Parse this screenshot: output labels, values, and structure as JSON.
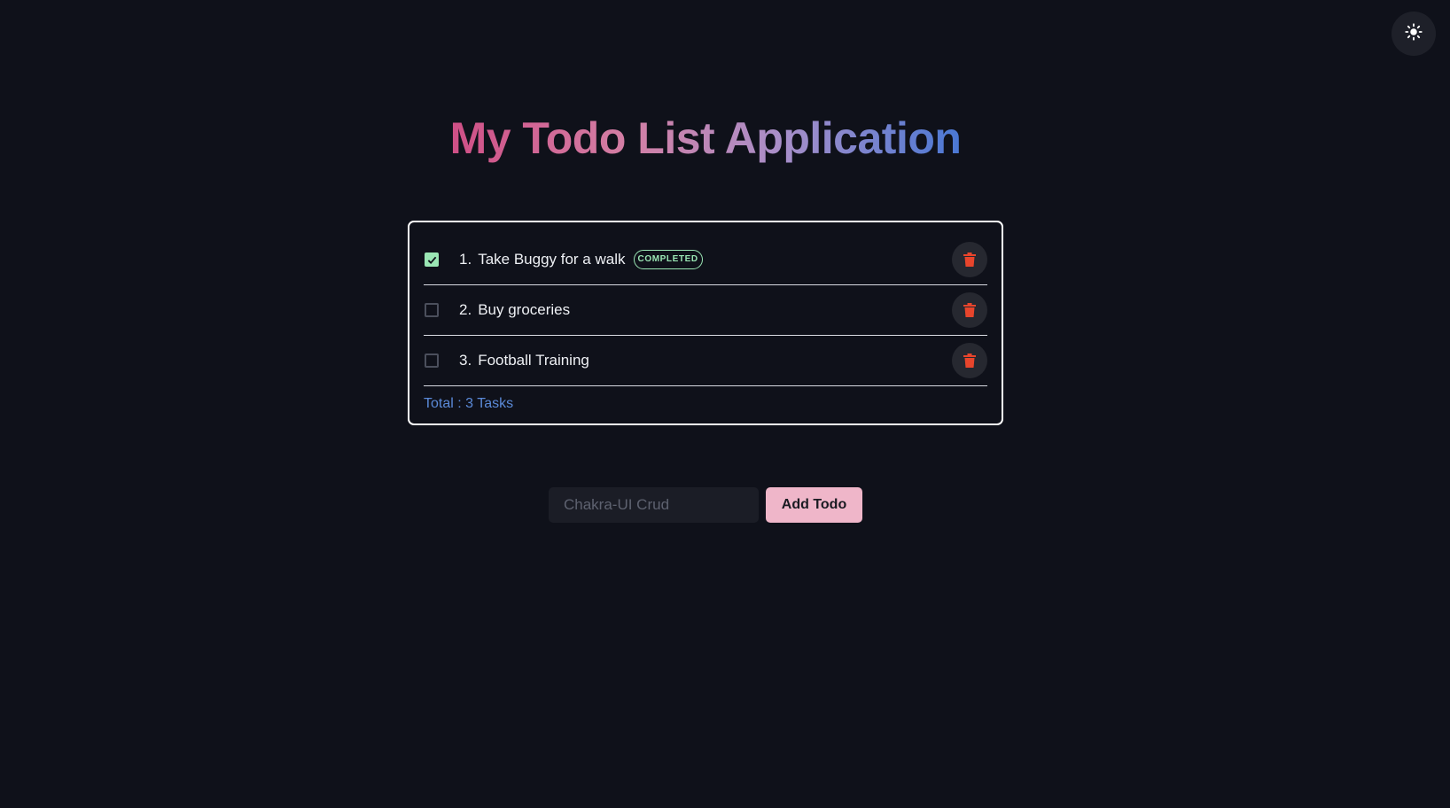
{
  "app": {
    "title": "My Todo List Application",
    "theme_toggle_icon": "sun-icon"
  },
  "todos": [
    {
      "number": "1.",
      "text": "Take Buggy for a walk",
      "completed": true,
      "badge": "COMPLETED",
      "delete_icon": "trash-icon"
    },
    {
      "number": "2.",
      "text": "Buy groceries",
      "completed": false,
      "badge": "",
      "delete_icon": "trash-icon"
    },
    {
      "number": "3.",
      "text": "Football Training",
      "completed": false,
      "badge": "",
      "delete_icon": "trash-icon"
    }
  ],
  "footer": {
    "total_label": "Total : 3 Tasks"
  },
  "form": {
    "input_value": "",
    "input_placeholder": "Chakra-UI Crud",
    "add_label": "Add Todo"
  },
  "colors": {
    "background": "#0f111a",
    "accent_button": "#efb6c9",
    "completed_green": "#9ae6b4",
    "total_blue": "#5b8ad8",
    "delete_red": "#e8452c"
  }
}
